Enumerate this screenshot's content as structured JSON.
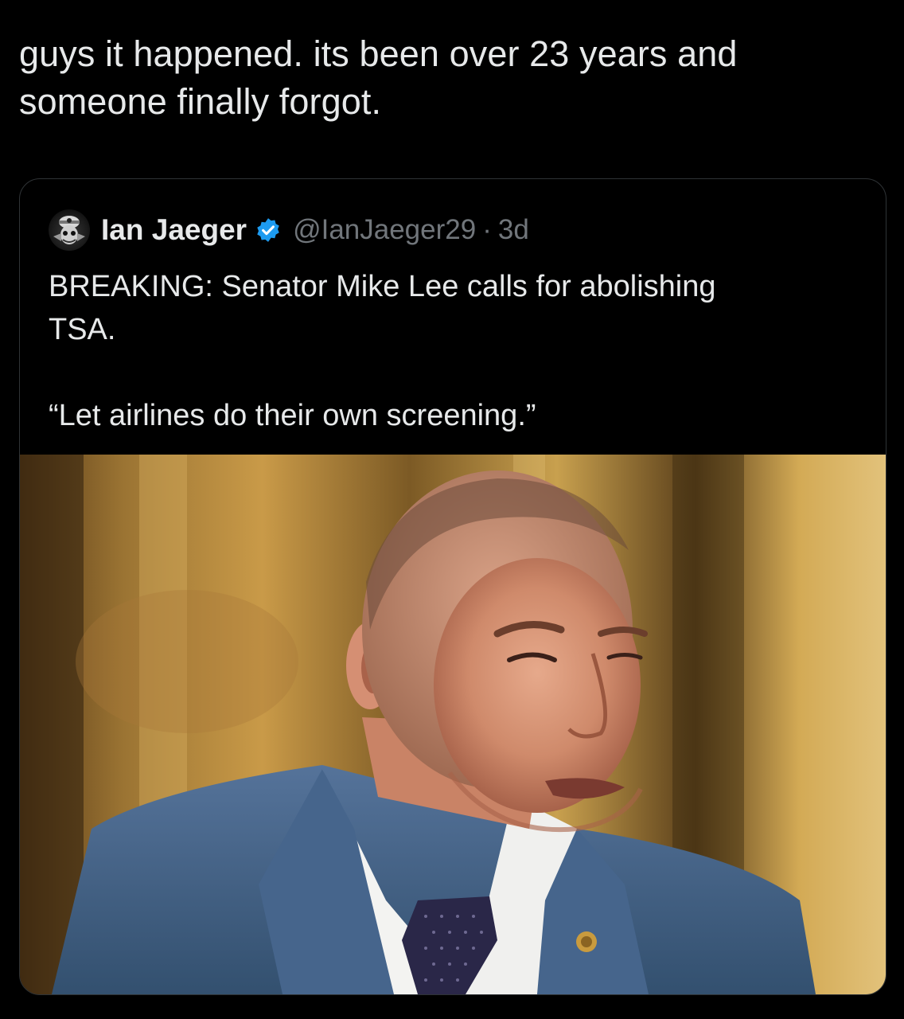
{
  "post": {
    "text_line_1": "guys it happened. its been over 23 years and",
    "text_line_2": "someone finally forgot."
  },
  "quoted_tweet": {
    "author_name": "Ian Jaeger",
    "handle": "@IanJaeger29",
    "separator": "·",
    "time": "3d",
    "body_line_1": "BREAKING: Senator Mike Lee calls for abolishing",
    "body_line_2": "TSA.",
    "quote": "“Let airlines do their own screening.”",
    "verified_color": "#1d9bf0",
    "avatar_icon": "skull-avatar-icon",
    "image_icon": "senator-photo"
  }
}
